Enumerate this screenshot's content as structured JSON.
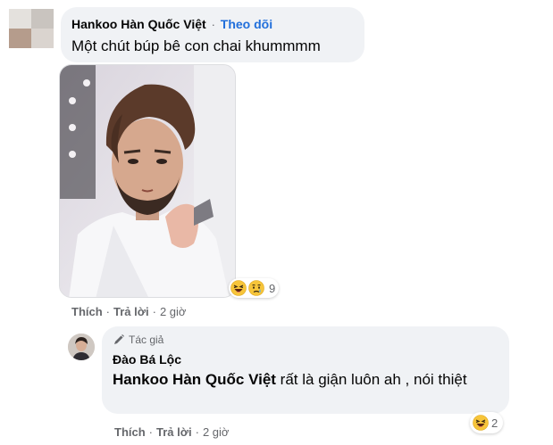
{
  "comment": {
    "author": "Hankoo Hàn Quốc Việt",
    "separator": "·",
    "follow_label": "Theo dõi",
    "text": "Một chút búp bê con chai khummmm",
    "reactions": {
      "icons": [
        "laughing-emoji",
        "crying-emoji"
      ],
      "count": "9"
    },
    "actions": {
      "like": "Thích",
      "reply": "Trả lời",
      "time": "2 giờ"
    }
  },
  "reply": {
    "badge": "Tác giả",
    "author": "Đào Bá Lộc",
    "mention": "Hankoo Hàn Quốc Việt",
    "text": " rất là giận luôn ah , nói thiệt",
    "reactions": {
      "icons": [
        "laughing-emoji"
      ],
      "count": "2"
    },
    "actions": {
      "like": "Thích",
      "reply": "Trả lời",
      "time": "2 giờ"
    }
  },
  "colors": {
    "bubble": "#f0f2f5",
    "follow_link": "#216fdb",
    "secondary_text": "#65676b",
    "primary_text": "#050505"
  }
}
